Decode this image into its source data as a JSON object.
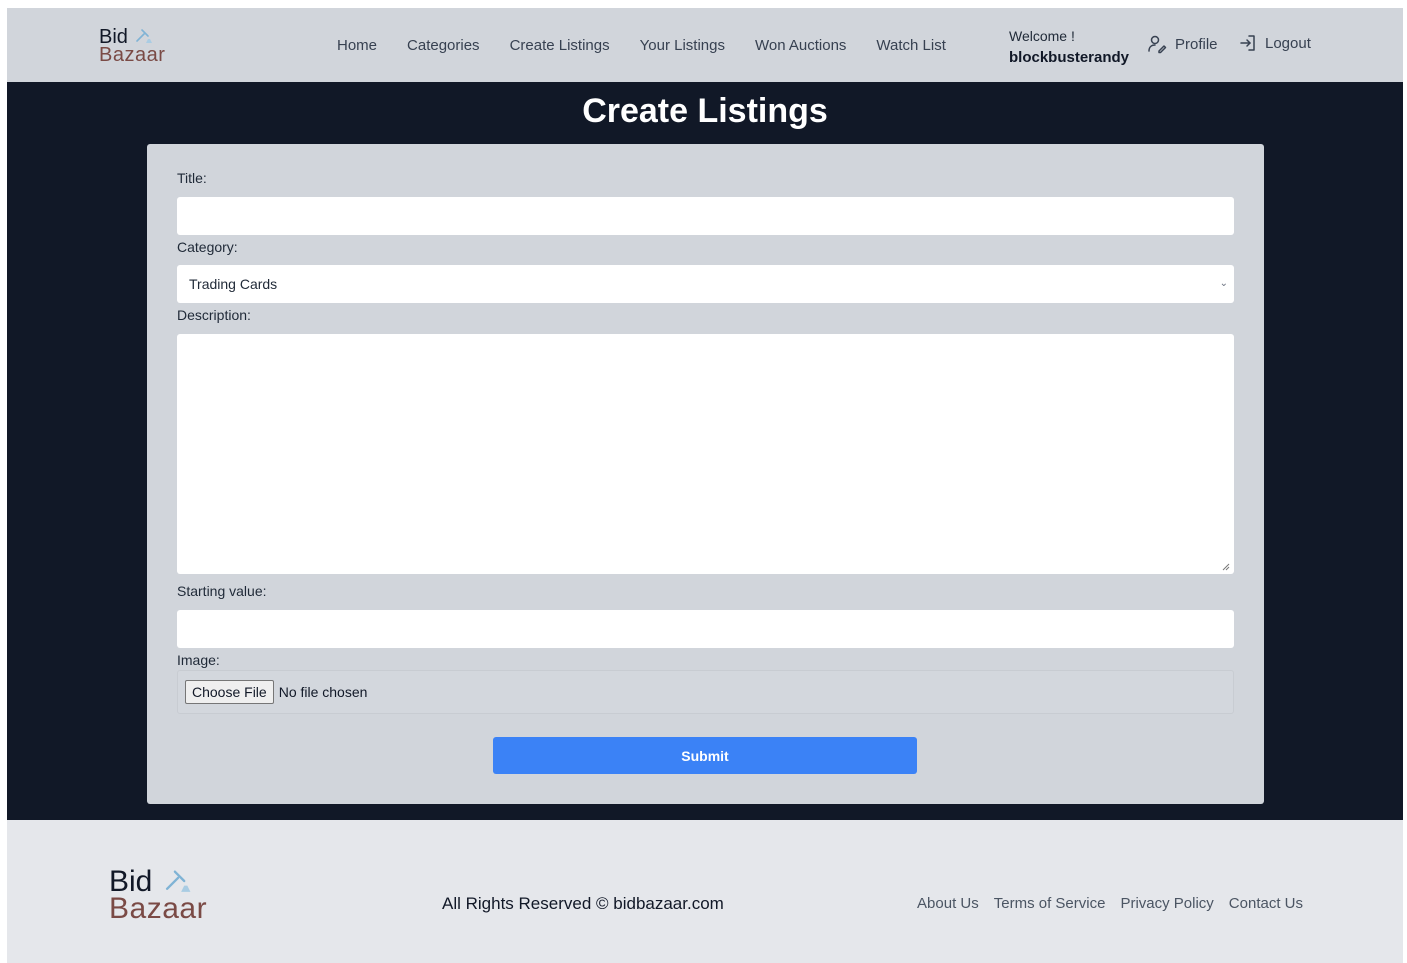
{
  "brand": {
    "line1": "Bid",
    "line2": "Bazaar"
  },
  "nav": [
    {
      "label": "Home"
    },
    {
      "label": "Categories"
    },
    {
      "label": "Create Listings"
    },
    {
      "label": "Your Listings"
    },
    {
      "label": "Won Auctions"
    },
    {
      "label": "Watch List"
    }
  ],
  "user": {
    "welcome": "Welcome !",
    "username": "blockbusterandy"
  },
  "header_links": {
    "profile": "Profile",
    "logout": "Logout"
  },
  "page": {
    "title": "Create Listings"
  },
  "form": {
    "title_label": "Title:",
    "title_value": "",
    "category_label": "Category:",
    "category_selected": "Trading Cards",
    "description_label": "Description:",
    "description_value": "",
    "starting_value_label": "Starting value:",
    "starting_value": "",
    "image_label": "Image:",
    "file_button": "Choose File",
    "file_status": "No file chosen",
    "submit_label": "Submit"
  },
  "footer": {
    "copyright": "All Rights Reserved © bidbazaar.com",
    "links": [
      {
        "label": "About Us"
      },
      {
        "label": "Terms of Service"
      },
      {
        "label": "Privacy Policy"
      },
      {
        "label": "Contact Us"
      }
    ]
  },
  "colors": {
    "header_bg": "#d1d5db",
    "page_bg": "#111827",
    "card_bg": "#d1d5db",
    "accent": "#3b82f6",
    "brand_secondary": "#7a4a45",
    "footer_bg": "#e5e7eb"
  },
  "icons": {
    "logo": "gavel-icon",
    "profile": "user-edit-icon",
    "logout": "logout-icon",
    "select": "chevron-down-icon"
  }
}
